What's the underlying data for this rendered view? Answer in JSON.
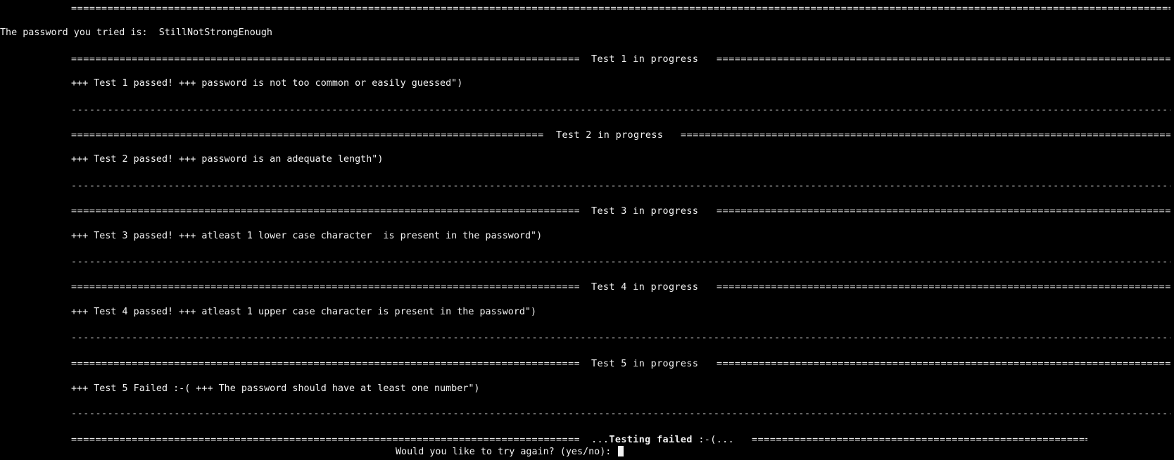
{
  "terminal": {
    "top_rule": "====================================================================================================================================================================================================================================",
    "equals_fill": "====================================================================================================================================================================================================================================",
    "dash_fill": "------------------------------------------------------------------------------------------------------------------------------------------------------------------------------------------------------------------------------------------------",
    "password_line": "The password you tried is:  StillNotStrongEnough",
    "tests": [
      {
        "header": "Test 1 in progress",
        "result": "+++ Test 1 passed! +++ password is not too common or easily guessed\")"
      },
      {
        "header": "Test 2 in progress",
        "result": "+++ Test 2 passed! +++ password is an adequate length\")"
      },
      {
        "header": "Test 3 in progress",
        "result": "+++ Test 3 passed! +++ atleast 1 lower case character  is present in the password\")"
      },
      {
        "header": "Test 4 in progress",
        "result": "+++ Test 4 passed! +++ atleast 1 upper case character is present in the password\")"
      },
      {
        "header": "Test 5 in progress",
        "result": "+++ Test 5 Failed :-( +++ The password should have at least one number\")"
      }
    ],
    "final_prefix": "...",
    "final_bold": "Testing failed",
    "final_suffix": " :-(...",
    "prompt": "Would you like to try again? (yes/no): "
  }
}
